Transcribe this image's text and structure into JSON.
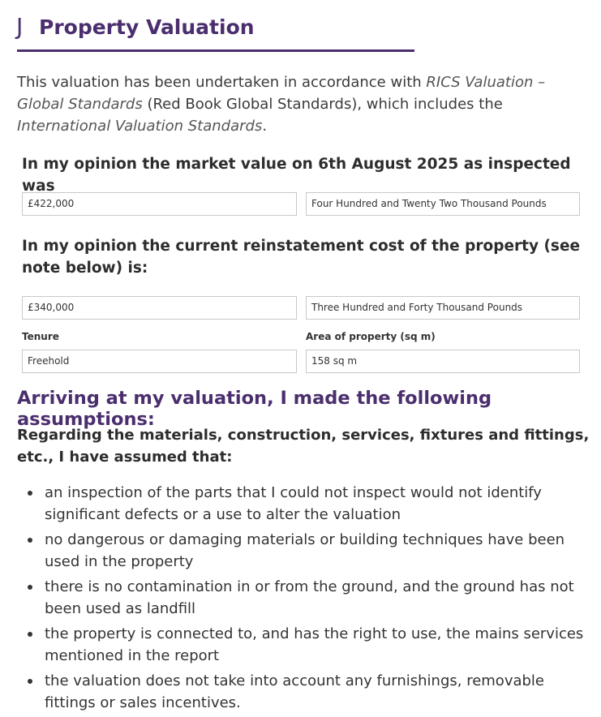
{
  "section": {
    "letter": "J",
    "title": "Property Valuation"
  },
  "intro": {
    "text_1": "This valuation has been undertaken in accordance with ",
    "italic_1": "RICS Valuation – Global Standards",
    "text_2": " (Red Book Global Standards), which includes the ",
    "italic_2": "International Valuation Standards",
    "text_3": "."
  },
  "market_value": {
    "label": "In my opinion the market value on 6th August 2025 as inspected was",
    "figure": "£422,000",
    "words": "Four Hundred and Twenty Two Thousand Pounds"
  },
  "reinstatement": {
    "label": "In my opinion the current reinstatement cost of the property (see note below) is:",
    "figure": "£340,000",
    "words": "Three Hundred and Forty Thousand Pounds"
  },
  "tenure": {
    "label": "Tenure",
    "value": "Freehold"
  },
  "area": {
    "label": "Area of property (sq m)",
    "value": "158 sq m"
  },
  "assumptions": {
    "heading": "Arriving at my valuation, I made the following assumptions:",
    "lead": "Regarding the materials, construction, services, fixtures and fittings, etc., I have assumed that:",
    "items": [
      "an inspection of the parts that I could not inspect would not identify significant defects or a use to alter the valuation",
      "no dangerous or damaging materials or building techniques have been used in the property",
      "there is no contamination in or from the ground, and the ground has not been used as landfill",
      "the property is connected to, and has the right to use, the mains services mentioned in the report",
      "the valuation does not take into account any furnishings, removable fittings or sales incentives."
    ]
  }
}
